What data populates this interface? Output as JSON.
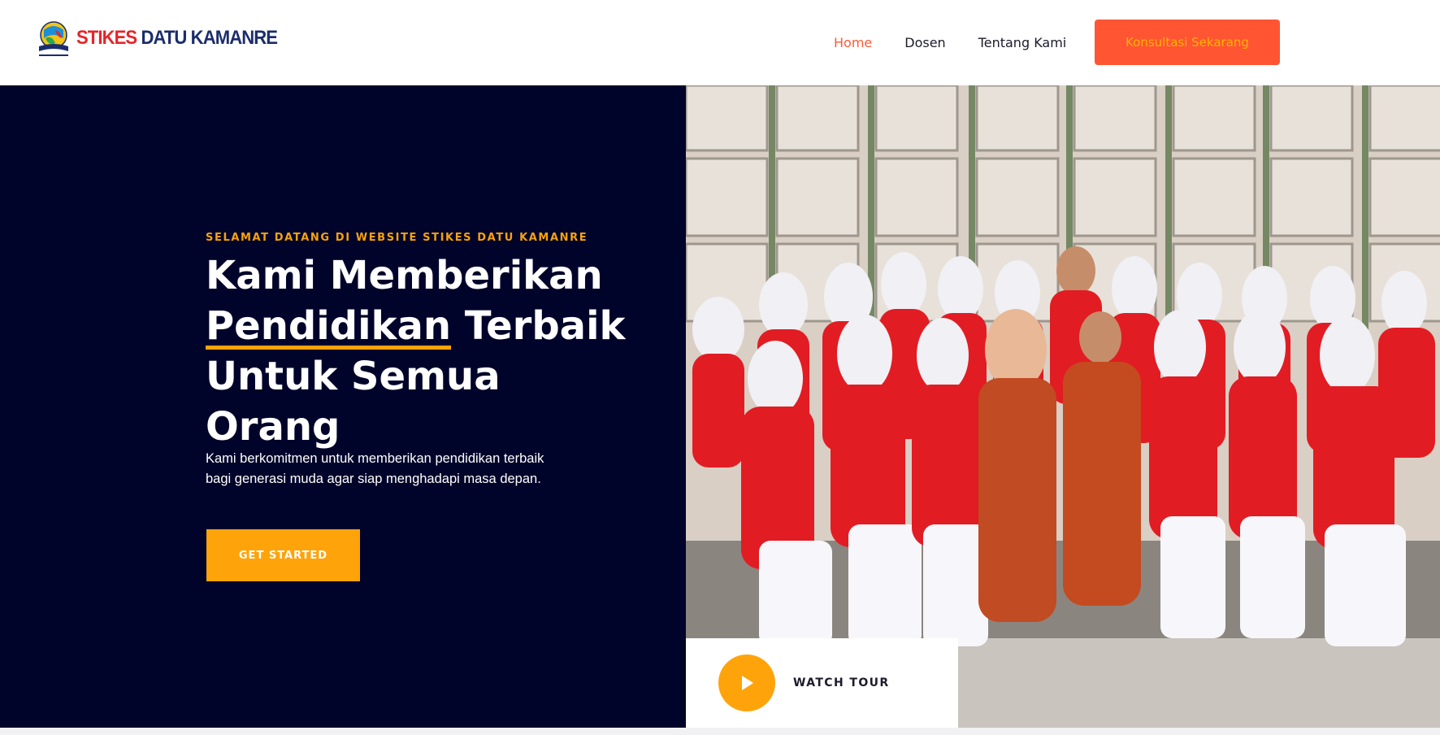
{
  "brand": {
    "name_part1": "STIKES",
    "name_part2": "DATU KAMANRE",
    "logo_icon": "globe-book-logo-icon"
  },
  "nav": {
    "items": [
      {
        "label": "Home",
        "active": true
      },
      {
        "label": "Dosen",
        "active": false
      },
      {
        "label": "Tentang Kami",
        "active": false
      }
    ],
    "cta_label": "Konsultasi Sekarang"
  },
  "hero": {
    "eyebrow": "SELAMAT DATANG DI WEBSITE STIKES DATU KAMANRE",
    "headline": {
      "line1": "Kami Memberikan",
      "line2_highlight": "Pendidikan",
      "line2_rest": " Terbaik",
      "line3": "Untuk Semua",
      "line4": "Orang"
    },
    "description": "Kami berkomitmen untuk memberikan pendidikan terbaik bagi generasi muda agar siap menghadapi masa depan.",
    "primary_button": "GET STARTED",
    "watch_tour": "WATCH TOUR",
    "play_icon": "play-icon",
    "photo": "group-photo-students-in-red-blazers"
  },
  "colors": {
    "accent_orange": "#ffa30b",
    "cta_red": "#ff5533",
    "nav_active": "#ff5a36",
    "hero_bg": "#01042a",
    "brand_red": "#e3262b",
    "brand_navy": "#1b2d6b"
  }
}
